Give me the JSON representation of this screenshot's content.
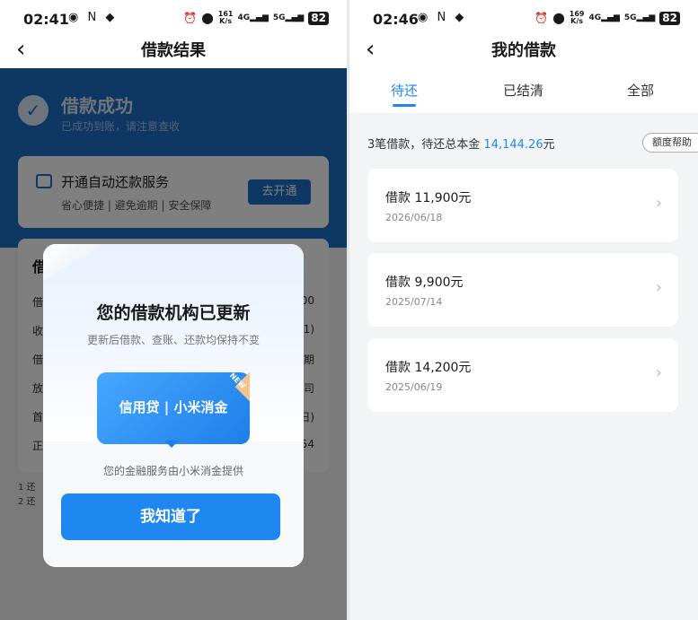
{
  "left_screen": {
    "status_bar": {
      "time": "02:41",
      "left_icons": "◉ N ◆",
      "network_speed_value": "161",
      "network_speed_unit": "K/s",
      "signal_1": "4G",
      "signal_2": "5G",
      "battery": "82"
    },
    "nav": {
      "back_icon": "back-chevron-icon",
      "title": "借款结果"
    },
    "background": {
      "success_title": "借款成功",
      "success_subtitle": "已成功到账，请注意查收",
      "auto_repay_title": "开通自动还款服务",
      "auto_repay_subtitle": "省心便捷 | 避免逾期 | 安全保障",
      "auto_repay_button": "去开通",
      "detail_title": "借款详情",
      "detail_rows": [
        {
          "label": "借",
          "value": "00"
        },
        {
          "label": "收",
          "value": "?1)"
        },
        {
          "label": "借",
          "value": "期"
        },
        {
          "label": "放",
          "value": "司"
        },
        {
          "label": "首",
          "value": "日)"
        },
        {
          "label": "正",
          "value": "54"
        }
      ],
      "footnotes": [
        "1 还",
        "2 还"
      ]
    },
    "modal": {
      "title": "您的借款机构已更新",
      "subtitle": "更新后借款、查账、还款均保持不变",
      "promo_label": "信用贷 | 小米消金",
      "new_badge": "NEW",
      "provider_text": "您的金融服务由小米消金提供",
      "confirm_button": "我知道了"
    }
  },
  "right_screen": {
    "status_bar": {
      "time": "02:46",
      "left_icons": "◉ N ◆",
      "network_speed_value": "169",
      "network_speed_unit": "K/s",
      "signal_1": "4G",
      "signal_2": "5G",
      "battery": "82"
    },
    "nav": {
      "back_icon": "back-chevron-icon",
      "title": "我的借款"
    },
    "tabs": [
      {
        "label": "待还",
        "active": true
      },
      {
        "label": "已结清",
        "active": false
      },
      {
        "label": "全部",
        "active": false
      }
    ],
    "summary_prefix": "3笔借款，待还总本金",
    "summary_amount": "14,144.26",
    "summary_suffix": "元",
    "help_button": "额度帮助",
    "loans": [
      {
        "title": "借款  11,900元",
        "date": "2026/06/18"
      },
      {
        "title": "借款  9,900元",
        "date": "2025/07/14"
      },
      {
        "title": "借款  14,200元",
        "date": "2025/06/19"
      }
    ]
  },
  "colors": {
    "accent": "#1e87f0",
    "header_blue": "#1e6fc8",
    "overlay": "rgba(0,0,0,0.5)"
  }
}
